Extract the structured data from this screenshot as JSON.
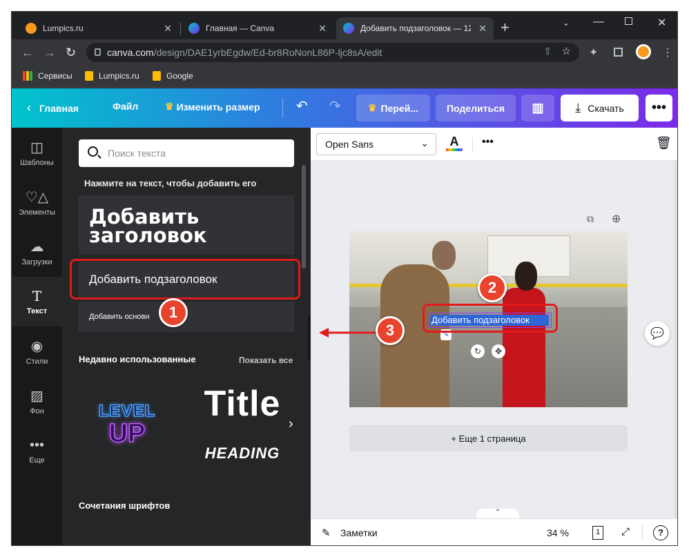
{
  "browser": {
    "tabs": [
      {
        "title": "Lumpics.ru",
        "favicon_color": "#f79a1c"
      },
      {
        "title": "Главная — Canva",
        "favicon_color": "#00c4cc"
      },
      {
        "title": "Добавить подзаголовок — 12",
        "favicon_color": "#00c4cc"
      }
    ],
    "url_host": "canva.com",
    "url_path": "/design/DAE1yrbEgdw/Ed-br8RoNonL86P-ljc8sA/edit",
    "bookmarks": [
      "Сервисы",
      "Lumpics.ru",
      "Google"
    ]
  },
  "header": {
    "home": "Главная",
    "file": "Файл",
    "resize": "Изменить размер",
    "pro": "Перей...",
    "share": "Поделиться",
    "download": "Скачать",
    "more": "•••"
  },
  "rail": [
    "Шаблоны",
    "Элементы",
    "Загрузки",
    "Текст",
    "Стили",
    "Фон",
    "Еще"
  ],
  "panel": {
    "search_placeholder": "Поиск текста",
    "hint": "Нажмите на текст, чтобы добавить его",
    "heading_line1": "Добавить",
    "heading_line2": "заголовок",
    "subheading": "Добавить подзаголовок",
    "body": "Добавить основн",
    "recent_title": "Недавно использованные",
    "show_all": "Показать все",
    "sample_level_top": "LEVEL",
    "sample_level_bottom": "UP",
    "sample_title": "Title",
    "sample_heading": "HEADING",
    "combos": "Сочетания шрифтов"
  },
  "editor": {
    "font": "Open Sans",
    "canvas_text": "Добавить подзаголовок",
    "add_page": "+ Еще 1 страница"
  },
  "status": {
    "notes": "Заметки",
    "zoom": "34 %",
    "page": "1",
    "help": "?"
  },
  "badges": [
    "1",
    "2",
    "3"
  ],
  "colors": {
    "accent_red": "#e21a1a",
    "selection_blue": "#2f66d6",
    "canva_teal": "#00c4cc",
    "canva_purple": "#7d2ae8"
  }
}
